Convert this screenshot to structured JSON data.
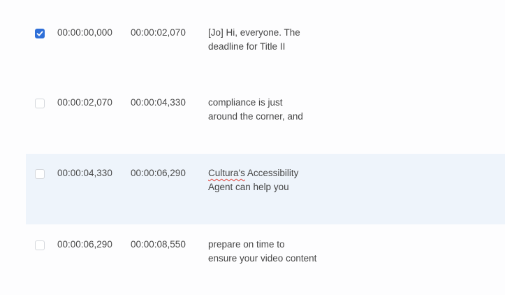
{
  "captions": [
    {
      "checked": true,
      "start": "00:00:00,000",
      "end": "00:00:02,070",
      "line1": "[Jo] Hi, everyone. The",
      "line2": "deadline for Title II"
    },
    {
      "checked": false,
      "start": "00:00:02,070",
      "end": "00:00:04,330",
      "line1": "compliance is just",
      "line2": "around the corner, and"
    },
    {
      "checked": false,
      "start": "00:00:04,330",
      "end": "00:00:06,290",
      "line1_misspelled": "Cultura's",
      "line1_rest": " Accessibility",
      "line2": "Agent can help you"
    },
    {
      "checked": false,
      "start": "00:00:06,290",
      "end": "00:00:08,550",
      "line1": "prepare on time to",
      "line2": "ensure your video content"
    }
  ],
  "colors": {
    "checkbox_checked": "#2f6fd8",
    "row_highlight": "#eef4fb",
    "spellcheck_underline": "#e0443c"
  }
}
